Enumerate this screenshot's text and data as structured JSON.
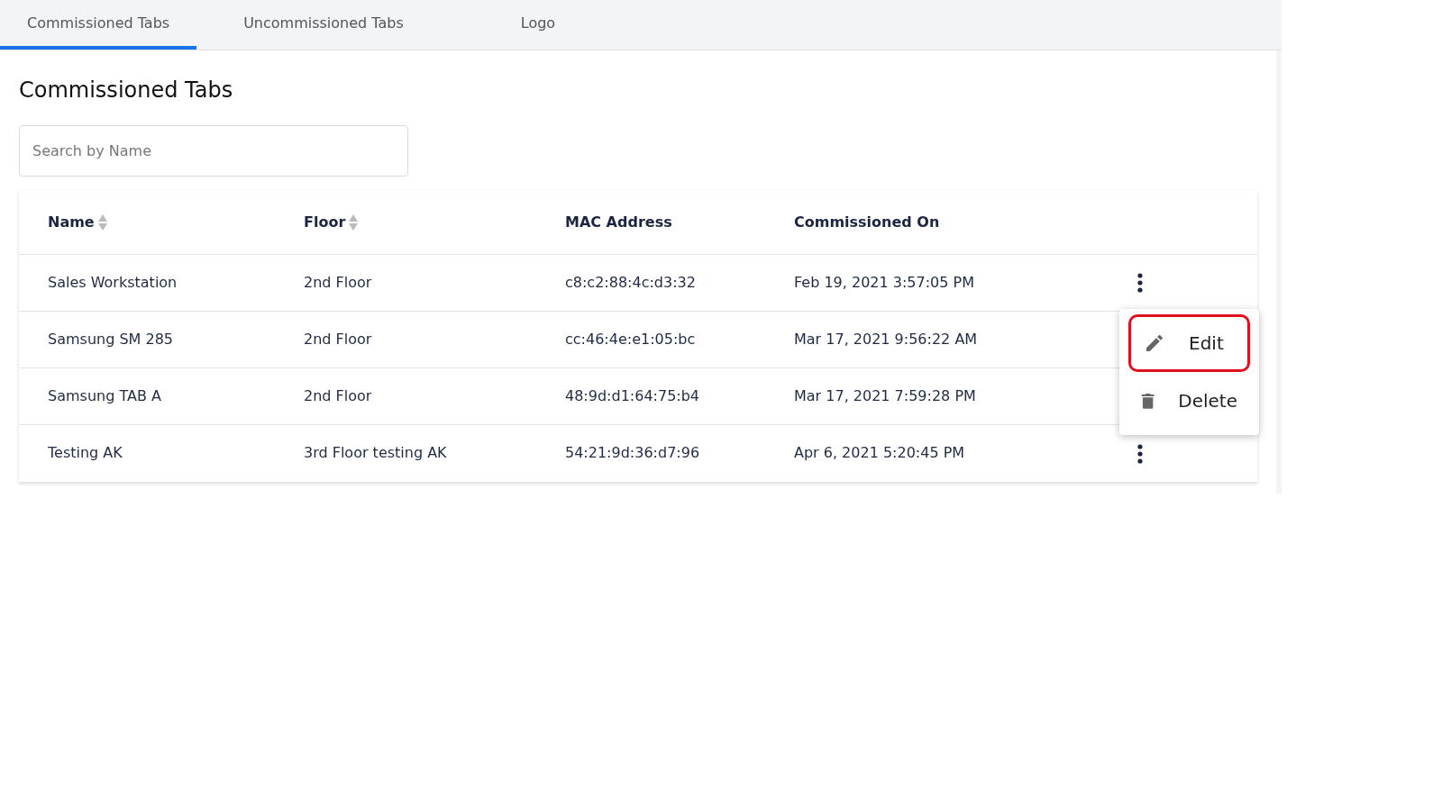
{
  "tabs": [
    {
      "label": "Commissioned Tabs",
      "selected": true
    },
    {
      "label": "Uncommissioned Tabs",
      "selected": false
    },
    {
      "label": "Logo",
      "selected": false
    }
  ],
  "heading": "Commissioned Tabs",
  "search": {
    "placeholder": "Search by Name"
  },
  "table": {
    "columns": [
      {
        "label": "Name",
        "sortable": true
      },
      {
        "label": "Floor",
        "sortable": true
      },
      {
        "label": "MAC Address",
        "sortable": false
      },
      {
        "label": "Commissioned On",
        "sortable": false
      }
    ],
    "rows": [
      {
        "cells": [
          "Sales Workstation",
          "2nd Floor",
          "c8:c2:88:4c:d3:32",
          "Feb 19, 2021 3:57:05 PM"
        ]
      },
      {
        "cells": [
          "Samsung SM 285",
          "2nd Floor",
          "cc:46:4e:e1:05:bc",
          "Mar 17, 2021 9:56:22 AM"
        ]
      },
      {
        "cells": [
          "Samsung TAB A",
          "2nd Floor",
          "48:9d:d1:64:75:b4",
          "Mar 17, 2021 7:59:28 PM"
        ]
      },
      {
        "cells": [
          "Testing AK",
          "3rd Floor testing AK",
          "54:21:9d:36:d7:96",
          "Apr 6, 2021 5:20:45 PM"
        ]
      }
    ]
  },
  "context_menu": {
    "items": [
      {
        "kind": "edit",
        "label": "Edit",
        "highlighted": true
      },
      {
        "kind": "delete",
        "label": "Delete",
        "highlighted": false
      }
    ]
  }
}
